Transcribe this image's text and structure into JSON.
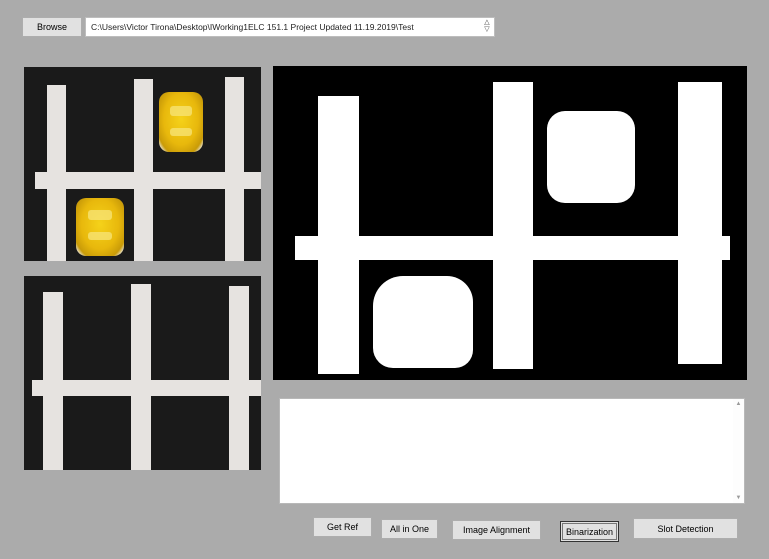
{
  "toolbar": {
    "browse_label": "Browse",
    "path_value": "C:\\Users\\Victor Tirona\\Desktop\\IWorking1ELC 151.1 Project Updated 11.19.2019\\Test"
  },
  "buttons": {
    "get_ref": "Get Ref",
    "all_in_one": "All in One",
    "image_alignment": "Image Alignment",
    "binarization": "Binarization",
    "slot_detection": "Slot Detection"
  },
  "output": {
    "text": ""
  },
  "icons": {
    "spin_up": "spin-up-icon",
    "spin_down": "spin-down-icon",
    "scroll_up": "scroll-up-arrow-icon",
    "scroll_down": "scroll-down-arrow-icon"
  },
  "colors": {
    "window_bg": "#ababab",
    "button_bg": "#e1e1e1",
    "panel_dark": "#1a1a1a",
    "tape": "#e6e3e0",
    "car_yellow": "#e8b80c"
  }
}
